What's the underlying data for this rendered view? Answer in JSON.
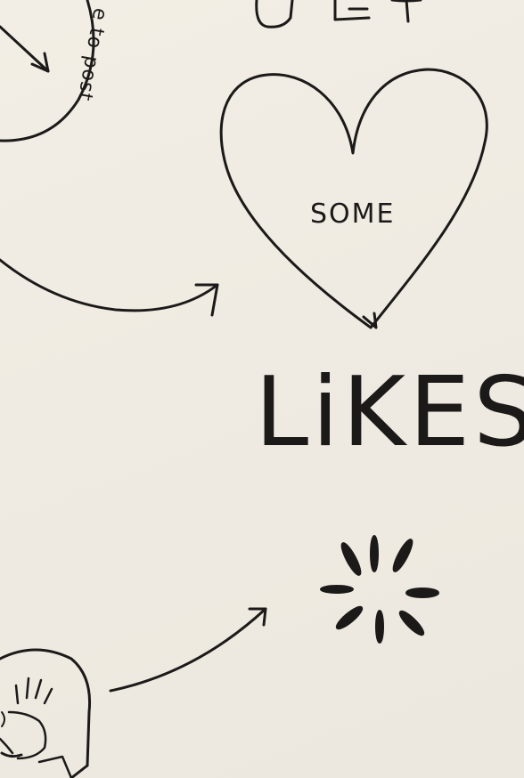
{
  "sketch": {
    "heart_text": "SOME",
    "big_word": "LiKES",
    "arc_text": "e to post"
  },
  "colors": {
    "paper": "#efebe2",
    "ink": "#1c1a19"
  }
}
